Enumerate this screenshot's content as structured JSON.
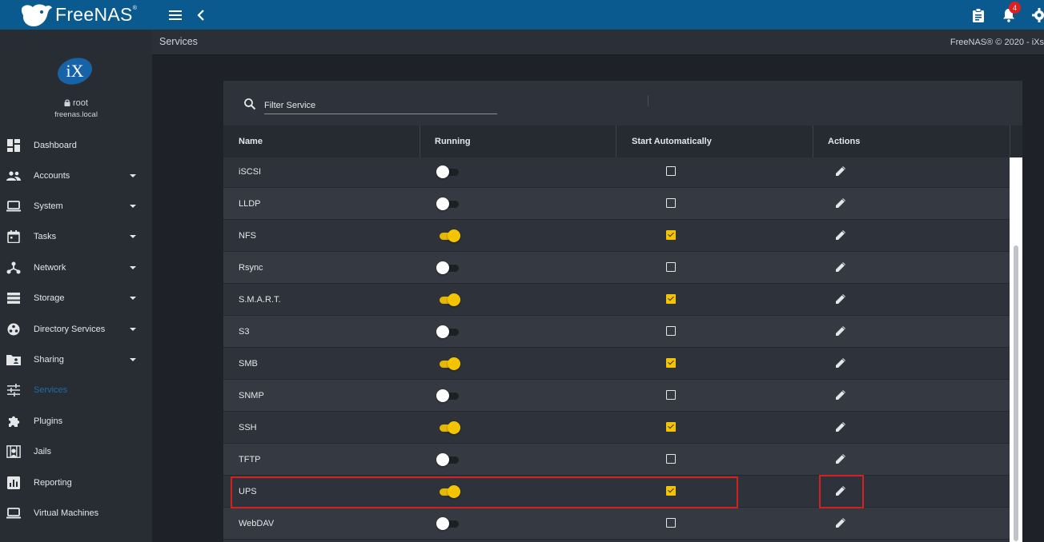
{
  "topbar": {
    "brand": "FreeNAS",
    "brand_tm": "®",
    "icons": [
      "menu-icon",
      "back-arrow-icon",
      "clipboard-icon",
      "bell-icon",
      "gear-icon"
    ],
    "notification_count": "4",
    "color": "#0a5a8f"
  },
  "user": {
    "name": "root",
    "host": "freenas.local",
    "avatar_label": "iX"
  },
  "sidebar": {
    "items": [
      {
        "label": "Dashboard",
        "icon": "dashboard-icon",
        "caret": false,
        "active": false
      },
      {
        "label": "Accounts",
        "icon": "people-icon",
        "caret": true,
        "active": false
      },
      {
        "label": "System",
        "icon": "laptop-icon",
        "caret": true,
        "active": false
      },
      {
        "label": "Tasks",
        "icon": "calendar-icon",
        "caret": true,
        "active": false
      },
      {
        "label": "Network",
        "icon": "network-icon",
        "caret": true,
        "active": false
      },
      {
        "label": "Storage",
        "icon": "storage-icon",
        "caret": true,
        "active": false
      },
      {
        "label": "Directory Services",
        "icon": "directory-icon",
        "caret": true,
        "active": false
      },
      {
        "label": "Sharing",
        "icon": "folder-share-icon",
        "caret": true,
        "active": false
      },
      {
        "label": "Services",
        "icon": "tune-icon",
        "caret": false,
        "active": true
      },
      {
        "label": "Plugins",
        "icon": "puzzle-icon",
        "caret": false,
        "active": false
      },
      {
        "label": "Jails",
        "icon": "jail-icon",
        "caret": false,
        "active": false
      },
      {
        "label": "Reporting",
        "icon": "chart-icon",
        "caret": false,
        "active": false
      },
      {
        "label": "Virtual Machines",
        "icon": "monitor-icon",
        "caret": false,
        "active": false
      }
    ],
    "active_color": "#1d6fa8"
  },
  "breadcrumb": {
    "current": "Services",
    "copyright": "FreeNAS® © 2020 - iXs"
  },
  "services": {
    "filter_placeholder": "Filter Service",
    "columns": [
      "Name",
      "Running",
      "Start Automatically",
      "Actions"
    ],
    "rows": [
      {
        "name": "iSCSI",
        "running": false,
        "auto": false
      },
      {
        "name": "LLDP",
        "running": false,
        "auto": false
      },
      {
        "name": "NFS",
        "running": true,
        "auto": true
      },
      {
        "name": "Rsync",
        "running": false,
        "auto": false
      },
      {
        "name": "S.M.A.R.T.",
        "running": true,
        "auto": true
      },
      {
        "name": "S3",
        "running": false,
        "auto": false
      },
      {
        "name": "SMB",
        "running": true,
        "auto": true
      },
      {
        "name": "SNMP",
        "running": false,
        "auto": false
      },
      {
        "name": "SSH",
        "running": true,
        "auto": true
      },
      {
        "name": "TFTP",
        "running": false,
        "auto": false
      },
      {
        "name": "UPS",
        "running": true,
        "auto": true
      },
      {
        "name": "WebDAV",
        "running": false,
        "auto": false
      }
    ],
    "accent_color": "#f5c400"
  }
}
